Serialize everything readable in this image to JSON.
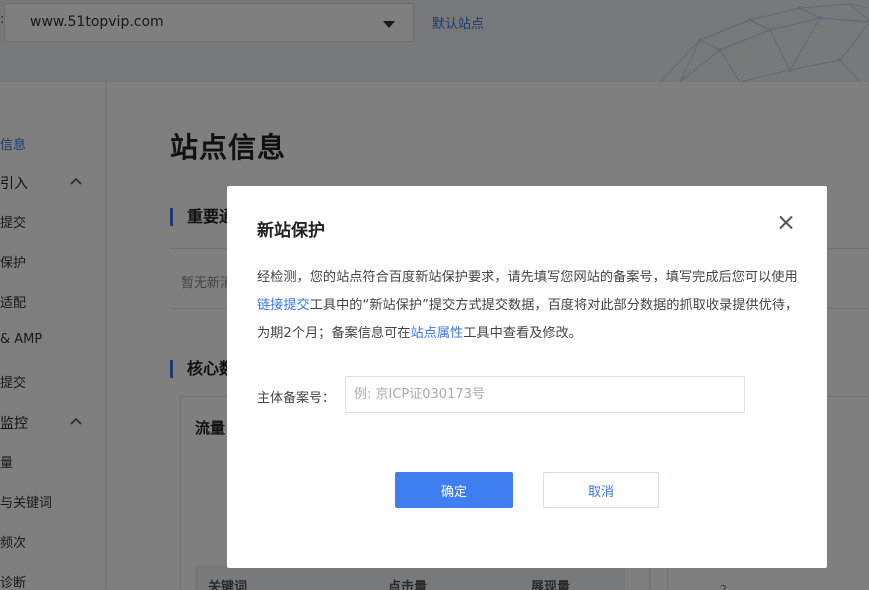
{
  "topbar": {
    "site_label": ":",
    "site_value": "www.51topvip.com",
    "default_site": "默认站点"
  },
  "sidebar": {
    "items": [
      {
        "label": "信息",
        "active": true
      },
      {
        "label": "引入",
        "group": true
      },
      {
        "label": "提交"
      },
      {
        "label": "保护"
      },
      {
        "label": "适配"
      },
      {
        "label": "& AMP"
      },
      {
        "label": "提交"
      },
      {
        "label": "监控",
        "group": true
      },
      {
        "label": "量"
      },
      {
        "label": "与关键词"
      },
      {
        "label": "频次"
      },
      {
        "label": "诊断"
      }
    ]
  },
  "main": {
    "page_title": "站点信息",
    "section1": "重要通",
    "empty_text": "暂无新消",
    "section2": "核心数",
    "card_title": "流量",
    "table_headers": [
      "关键词",
      "点击量",
      "展现量"
    ],
    "axis_value": "2"
  },
  "modal": {
    "title": "新站保护",
    "desc_part1": "经检测，您的站点符合百度新站保护要求，请先填写您网站的备案号，填写完成后您可以使用",
    "desc_link1": "链接提交",
    "desc_part2": "工具中的“新站保护”提交方式提交数据，百度将对此部分数据的抓取收录提供优待，为期2个月；备案信息可在",
    "desc_link2": "站点属性",
    "desc_part3": "工具中查看及修改。",
    "field_label": "主体备案号：",
    "field_value": "",
    "field_placeholder": "例: 京ICP证030173号",
    "confirm": "确定",
    "cancel": "取消"
  },
  "colors": {
    "accent": "#3b76e1",
    "primary_button": "#3f7ff1",
    "overlay": "rgba(0,0,0,0.5)"
  }
}
